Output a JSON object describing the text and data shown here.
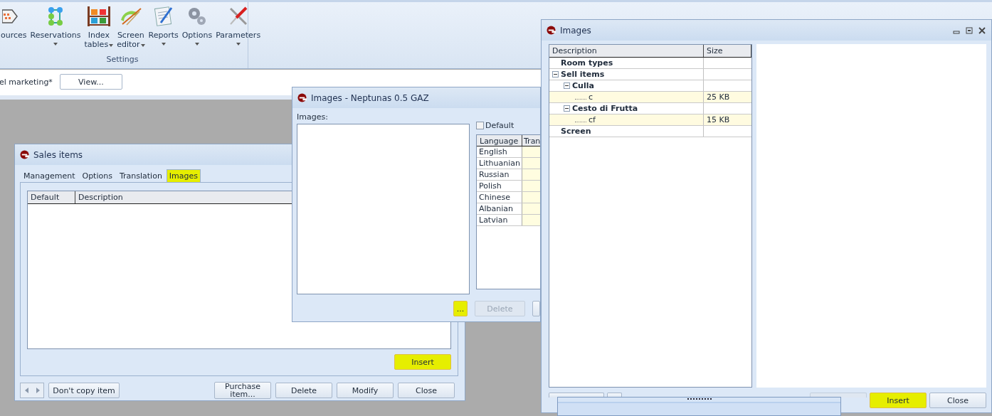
{
  "ribbon": {
    "items": [
      {
        "label": "ources",
        "kind": "button"
      },
      {
        "label": "Reservations",
        "kind": "menu"
      },
      {
        "label": "Index tables",
        "kind": "inline_menu"
      },
      {
        "label": "Screen editor",
        "kind": "inline_menu"
      },
      {
        "label": "Reports",
        "kind": "menu"
      },
      {
        "label": "Options",
        "kind": "menu"
      },
      {
        "label": "Parameters",
        "kind": "menu"
      }
    ],
    "group_label": "Settings"
  },
  "toolbar": {
    "label": "el marketing*",
    "button": "View..."
  },
  "sales_window": {
    "title": "Sales items",
    "tabs": [
      {
        "label": "Management",
        "selected": false,
        "highlighted": false
      },
      {
        "label": "Options",
        "selected": false,
        "highlighted": false
      },
      {
        "label": "Translation",
        "selected": false,
        "highlighted": false
      },
      {
        "label": "Images",
        "selected": true,
        "highlighted": true
      }
    ],
    "columns": [
      "Default",
      "Description"
    ],
    "insert_button": {
      "label": "Insert",
      "highlighted": true
    },
    "buttons": [
      {
        "label": "Don't copy item"
      },
      {
        "label": "Purchase item..."
      },
      {
        "label": "Delete"
      },
      {
        "label": "Modify"
      },
      {
        "label": "Close"
      }
    ]
  },
  "neptunas_window": {
    "title": "Images - Neptunas 0.5 GAZ",
    "images_label": "Images:",
    "default_checkbox": {
      "label": "Default",
      "checked": false
    },
    "columns": [
      "Language",
      "Tran"
    ],
    "languages": [
      "English",
      "Lithuanian",
      "Russian",
      "Polish",
      "Chinese",
      "Albanian",
      "Latvian"
    ],
    "buttons": [
      {
        "label": "...",
        "highlighted": true,
        "disabled": false
      },
      {
        "label": "Delete",
        "highlighted": false,
        "disabled": true
      }
    ]
  },
  "images_window": {
    "title": "Images",
    "columns": [
      "Description",
      "Size"
    ],
    "tree": [
      {
        "label": "Room types",
        "kind": "group"
      },
      {
        "label": "Sell items",
        "kind": "group",
        "expanded": true,
        "children": [
          {
            "label": "Culla",
            "kind": "group",
            "expanded": true,
            "children": [
              {
                "label": "c",
                "kind": "file",
                "size": "25 KB"
              }
            ]
          },
          {
            "label": "Cesto di Frutta",
            "kind": "group",
            "expanded": true,
            "children": [
              {
                "label": "cf",
                "kind": "file",
                "size": "15 KB"
              }
            ]
          }
        ]
      },
      {
        "label": "Screen",
        "kind": "group"
      }
    ],
    "buttons": [
      {
        "label": "Insert",
        "highlighted": true
      },
      {
        "label": "Close",
        "highlighted": false
      }
    ]
  }
}
